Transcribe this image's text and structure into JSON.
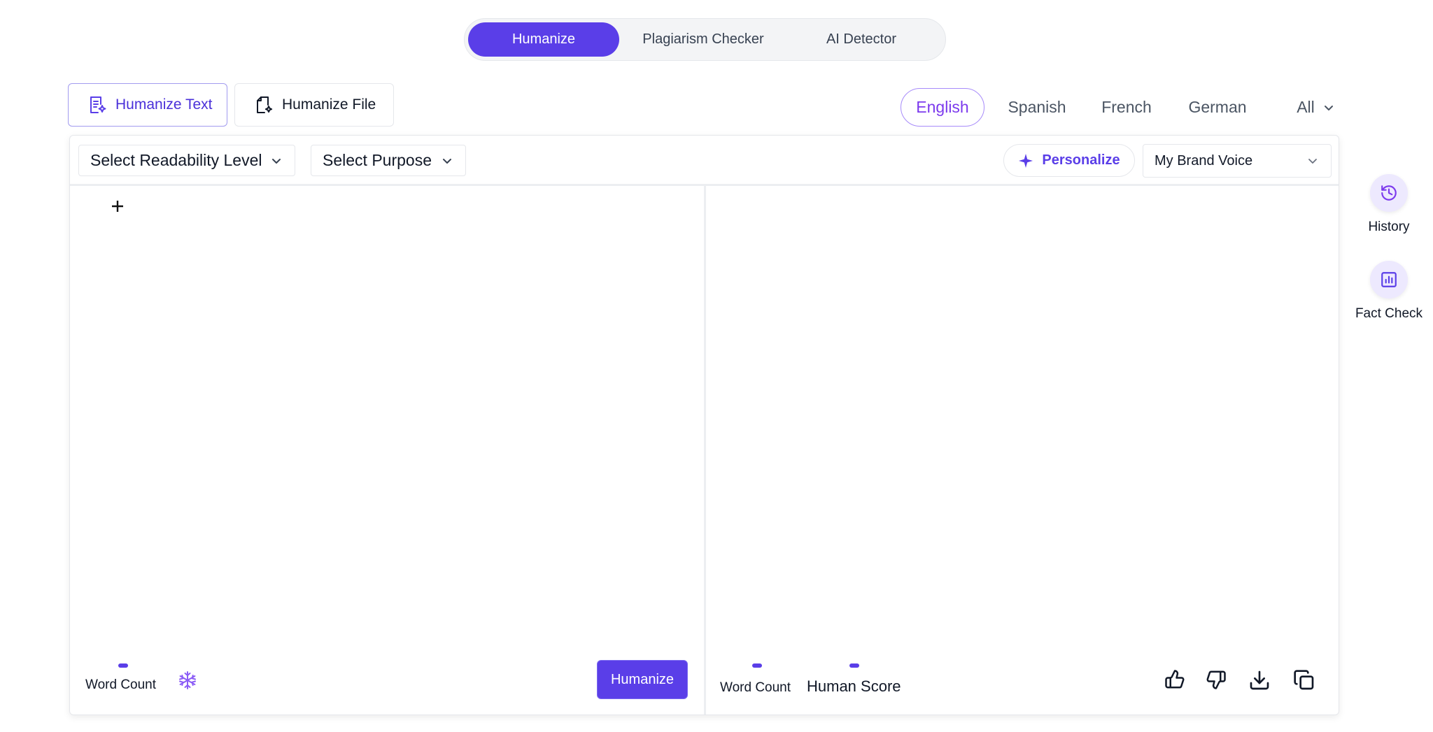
{
  "top_tabs": [
    "Humanize",
    "Plagiarism Checker",
    "AI Detector"
  ],
  "modes": {
    "text": "Humanize Text",
    "file": "Humanize File"
  },
  "languages": [
    "English",
    "Spanish",
    "French",
    "German",
    "All"
  ],
  "toolbar": {
    "readability": "Select Readability Level",
    "purpose": "Select Purpose",
    "personalize": "Personalize",
    "brand_voice": "My Brand Voice"
  },
  "left_footer": {
    "word_count": "Word Count",
    "humanize_button": "Humanize"
  },
  "right_footer": {
    "word_count": "Word Count",
    "human_score": "Human Score"
  },
  "rail": {
    "history": "History",
    "fact_check": "Fact Check"
  },
  "colors": {
    "primary": "#5a3ee8",
    "accent": "#7c3aed",
    "border": "#e5e7eb"
  }
}
